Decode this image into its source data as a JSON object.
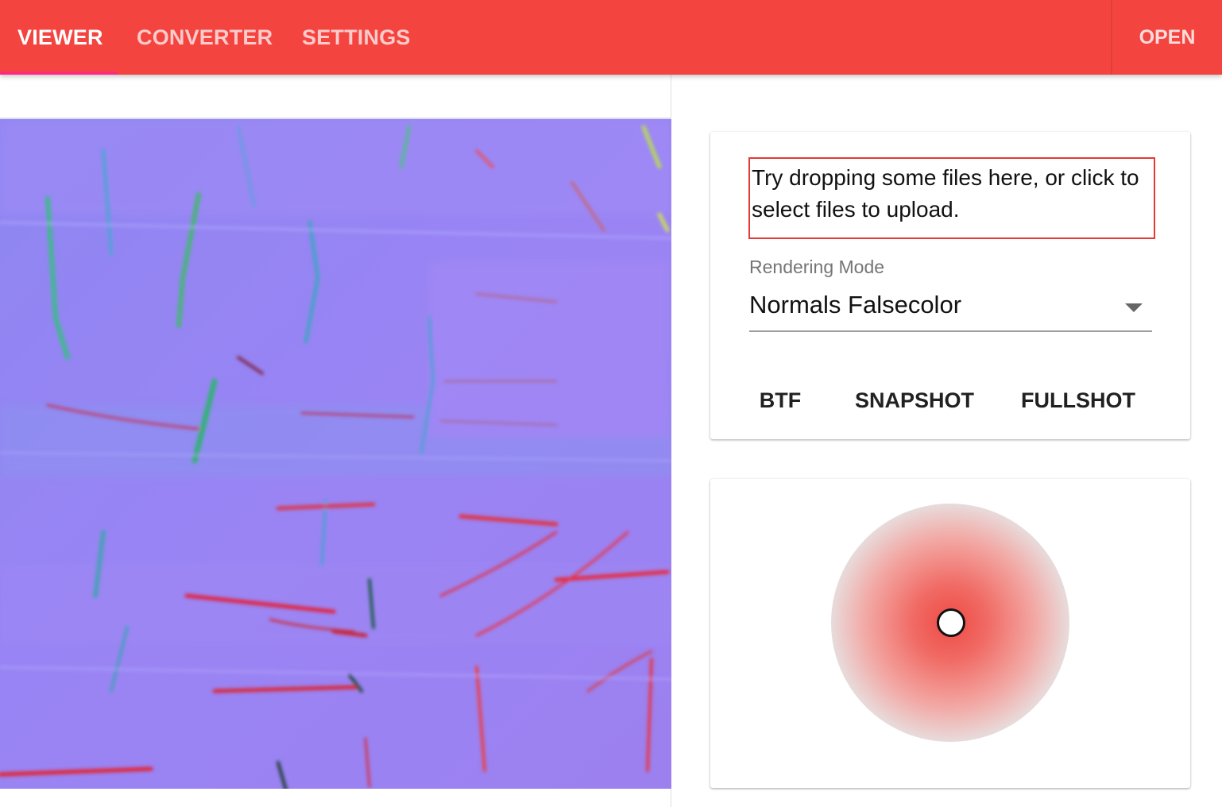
{
  "appbar": {
    "tabs": [
      {
        "label": "VIEWER",
        "active": true
      },
      {
        "label": "CONVERTER",
        "active": false
      },
      {
        "label": "SETTINGS",
        "active": false
      }
    ],
    "open_label": "OPEN",
    "color": "#f44440",
    "indicator_color": "#ff2a7a"
  },
  "viewer": {
    "canvas_icon": "normal-map-render"
  },
  "controls": {
    "dropzone_text": "Try dropping some files here, or click to select files to upload.",
    "rendering_mode_label": "Rendering Mode",
    "rendering_mode_value": "Normals Falsecolor",
    "buttons": {
      "btf": "BTF",
      "snapshot": "SNAPSHOT",
      "fullshot": "FULLSHOT"
    }
  },
  "light_control": {
    "accent_color": "#ee4a45"
  }
}
